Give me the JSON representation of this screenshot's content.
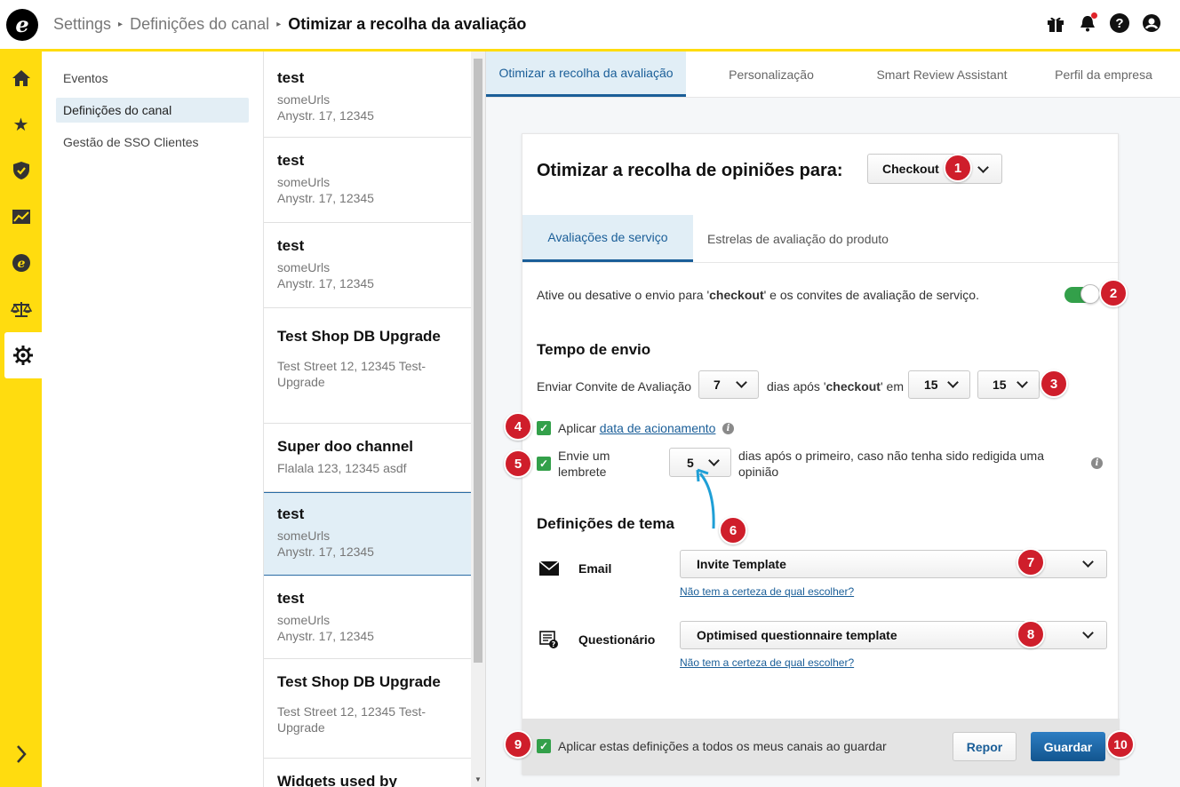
{
  "header": {
    "logo_letter": "e",
    "breadcrumb": [
      "Settings",
      "Definições do canal"
    ],
    "current": "Otimizar a recolha da avaliação"
  },
  "nav": {
    "items": [
      {
        "label": "Eventos"
      },
      {
        "label": "Definições do canal"
      },
      {
        "label": "Gestão de SSO Clientes"
      }
    ]
  },
  "channels": [
    {
      "name": "test",
      "lines": [
        "someUrls",
        "Anystr. 17, 12345"
      ]
    },
    {
      "name": "test",
      "lines": [
        "someUrls",
        "Anystr. 17, 12345"
      ]
    },
    {
      "name": "test",
      "lines": [
        "someUrls",
        "Anystr. 17, 12345"
      ]
    },
    {
      "name": "Test Shop DB Upgrade",
      "lines": [
        "Test Street 12, 12345 Test-",
        "Upgrade"
      ]
    },
    {
      "name": "Super doo channel",
      "lines": [
        "Flalala 123, 12345 asdf"
      ]
    },
    {
      "name": "test",
      "lines": [
        "someUrls",
        "Anystr. 17, 12345"
      ]
    },
    {
      "name": "test",
      "lines": [
        "someUrls",
        "Anystr. 17, 12345"
      ]
    },
    {
      "name": "Test Shop DB Upgrade",
      "lines": [
        "Test Street 12, 12345 Test-",
        "Upgrade"
      ]
    },
    {
      "name": "Widgets used by",
      "lines": []
    }
  ],
  "tabs": [
    {
      "label": "Otimizar a recolha da avaliação"
    },
    {
      "label": "Personalização"
    },
    {
      "label": "Smart Review Assistant"
    },
    {
      "label": "Perfil da empresa"
    }
  ],
  "card": {
    "title": "Otimizar a recolha de opiniões para:",
    "event_select": "Checkout",
    "subtabs": [
      {
        "label": "Avaliações de serviço"
      },
      {
        "label": "Estrelas de avaliação do produto"
      }
    ],
    "toggle_text_pre": "Ative ou desative o envio para '",
    "toggle_text_bold": "checkout",
    "toggle_text_post": "' e os convites de avaliação de serviço.",
    "toggle_on": true,
    "send_time_heading": "Tempo de envio",
    "send_label": "Enviar Convite de Avaliação",
    "days_value": "7",
    "days_after_pre": "dias após '",
    "days_after_bold": "checkout",
    "days_after_post": "' em",
    "hour_value": "15",
    "minute_value": "15",
    "apply_label": "Aplicar",
    "apply_link": "data de acionamento",
    "reminder_label_1": "Envie um",
    "reminder_label_2": "lembrete",
    "reminder_value": "5",
    "reminder_after_1": "dias após o primeiro, caso não tenha sido redigida uma",
    "reminder_after_2": "opinião",
    "theme_heading": "Definições de tema",
    "email_label": "Email",
    "email_template": "Invite Template",
    "email_help": "Não tem a certeza de qual escolher?",
    "questionnaire_label": "Questionário",
    "questionnaire_template": "Optimised questionnaire template",
    "questionnaire_help": "Não tem a certeza de qual escolher?",
    "apply_all_label": "Aplicar estas definições a todos os meus canais ao guardar",
    "reset_button": "Repor",
    "save_button": "Guardar"
  },
  "badges": [
    "1",
    "2",
    "3",
    "4",
    "5",
    "6",
    "7",
    "8",
    "9",
    "10"
  ],
  "colors": {
    "accent_yellow": "#ffdc0f",
    "primary_blue": "#1a5e98",
    "badge_red": "#cf1e2b",
    "toggle_green": "#33a04a"
  }
}
